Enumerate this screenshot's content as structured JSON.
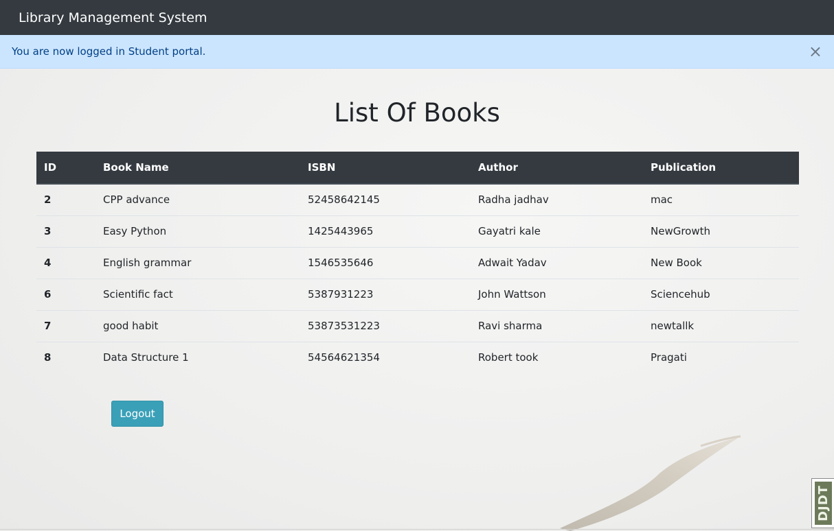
{
  "navbar": {
    "brand": "Library Management System"
  },
  "alert": {
    "message": "You are now logged in Student portal.",
    "close_icon": "×"
  },
  "page": {
    "title": "List Of Books"
  },
  "table": {
    "headers": [
      "ID",
      "Book Name",
      "ISBN",
      "Author",
      "Publication"
    ],
    "rows": [
      [
        "2",
        "CPP advance",
        "52458642145",
        "Radha jadhav",
        "mac"
      ],
      [
        "3",
        "Easy Python",
        "1425443965",
        "Gayatri kale",
        "NewGrowth"
      ],
      [
        "4",
        "English grammar",
        "1546535646",
        "Adwait Yadav",
        "New Book"
      ],
      [
        "6",
        "Scientific fact",
        "5387931223",
        "John Wattson",
        "Sciencehub"
      ],
      [
        "7",
        "good habit",
        "53873531223",
        "Ravi sharma",
        "newtallk"
      ],
      [
        "8",
        "Data Structure 1",
        "54564621354",
        "Robert took",
        "Pragati"
      ]
    ]
  },
  "actions": {
    "logout_label": "Logout"
  },
  "debug_toolbar": {
    "label": "DJDT"
  },
  "colors": {
    "navbar": "#343a40",
    "alert_bg": "#cce5ff",
    "alert_text": "#004085",
    "button": "#3aa0b8"
  }
}
